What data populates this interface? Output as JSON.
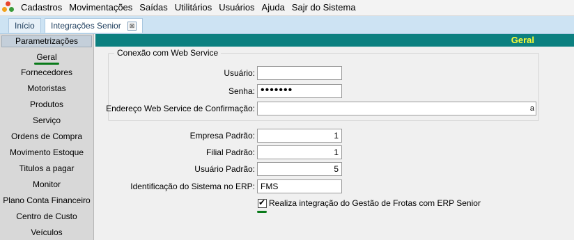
{
  "menubar": {
    "items": [
      {
        "label": "Cadastros"
      },
      {
        "label": "Movimentações"
      },
      {
        "label": "Saídas"
      },
      {
        "label": "Utilitários"
      },
      {
        "label": "Usuários"
      },
      {
        "label": "Ajuda"
      },
      {
        "label": "Sajr do Sistema"
      }
    ]
  },
  "tabs": [
    {
      "label": "Início"
    },
    {
      "label": "Integrações Senior",
      "close": "⊠"
    }
  ],
  "sidebar": {
    "header": "Parametrizações",
    "items": [
      {
        "label": "Geral"
      },
      {
        "label": "Fornecedores"
      },
      {
        "label": "Motoristas"
      },
      {
        "label": "Produtos"
      },
      {
        "label": "Serviço"
      },
      {
        "label": "Ordens de Compra"
      },
      {
        "label": "Movimento Estoque"
      },
      {
        "label": "Titulos a pagar"
      },
      {
        "label": "Monitor"
      },
      {
        "label": "Plano Conta Financeiro"
      },
      {
        "label": "Centro de Custo"
      },
      {
        "label": "Veículos"
      }
    ]
  },
  "content": {
    "title": "Geral",
    "group_title": "Conexão com Web Service",
    "usuario_label": "Usuário:",
    "usuario_value": "",
    "senha_label": "Senha:",
    "senha_value": "•••••••",
    "endereco_label": "Endereço Web Service de Confirmação:",
    "endereco_value": "",
    "endereco_overflow": "a",
    "empresa_label": "Empresa Padrão:",
    "empresa_value": "1",
    "filial_label": "Filial Padrão:",
    "filial_value": "1",
    "usuario_padrao_label": "Usuário Padrão:",
    "usuario_padrao_value": "5",
    "sistema_label": "Identificação do Sistema no ERP:",
    "sistema_value": "FMS",
    "integracao_label": "Realiza integração do Gestão de Frotas com ERP Senior",
    "integracao_checked": true
  },
  "colors": {
    "header_bg": "#0c8080",
    "header_title": "#ffff33",
    "active_marker": "#0a7a1a"
  }
}
